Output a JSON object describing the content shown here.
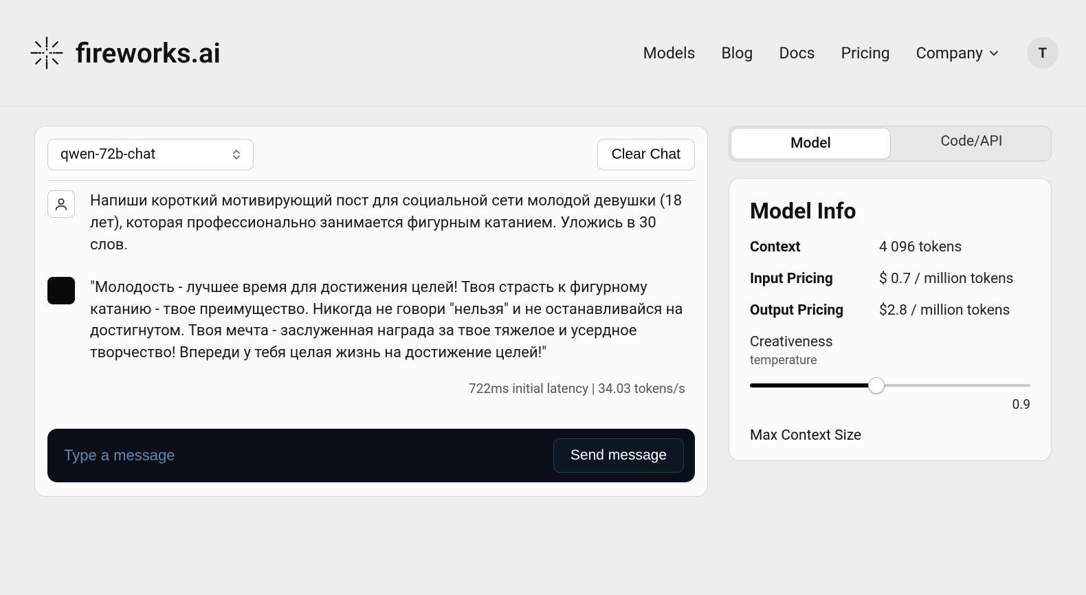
{
  "brand": {
    "name": "fireworks.ai"
  },
  "nav": {
    "models": "Models",
    "blog": "Blog",
    "docs": "Docs",
    "pricing": "Pricing",
    "company": "Company"
  },
  "avatar_initial": "T",
  "chat": {
    "model_selected": "qwen-72b-chat",
    "clear_label": "Clear Chat",
    "user_message": "Напиши короткий мотивирующий пост для социальной сети молодой девушки (18 лет), которая профессионально занимается фигурным катанием. Уложись в 30 слов.",
    "bot_message": "\"Молодость - лучшее время для достижения целей! Твоя страсть к фигурному катанию - твое преимущество. Никогда не говори \"нельзя\" и не останавливайся на достигнутом. Твоя мечта - заслуженная награда за твое тяжелое и усердное творчество! Впереди у тебя целая жизнь на достижение целей!\"",
    "latency_text": "722ms initial latency | 34.03 tokens/s",
    "composer_placeholder": "Type a message",
    "send_label": "Send message"
  },
  "tabs": {
    "model": "Model",
    "code": "Code/API"
  },
  "info": {
    "title": "Model Info",
    "rows": {
      "context_label": "Context",
      "context_value": "4 096 tokens",
      "input_label": "Input Pricing",
      "input_value": "$ 0.7 / million tokens",
      "output_label": "Output Pricing",
      "output_value": "$2.8 / million tokens"
    },
    "creativeness_title": "Creativeness",
    "creativeness_sub": "temperature",
    "temperature_value": "0.9",
    "temperature_fill_pct": "45",
    "max_context_label": "Max Context Size"
  }
}
